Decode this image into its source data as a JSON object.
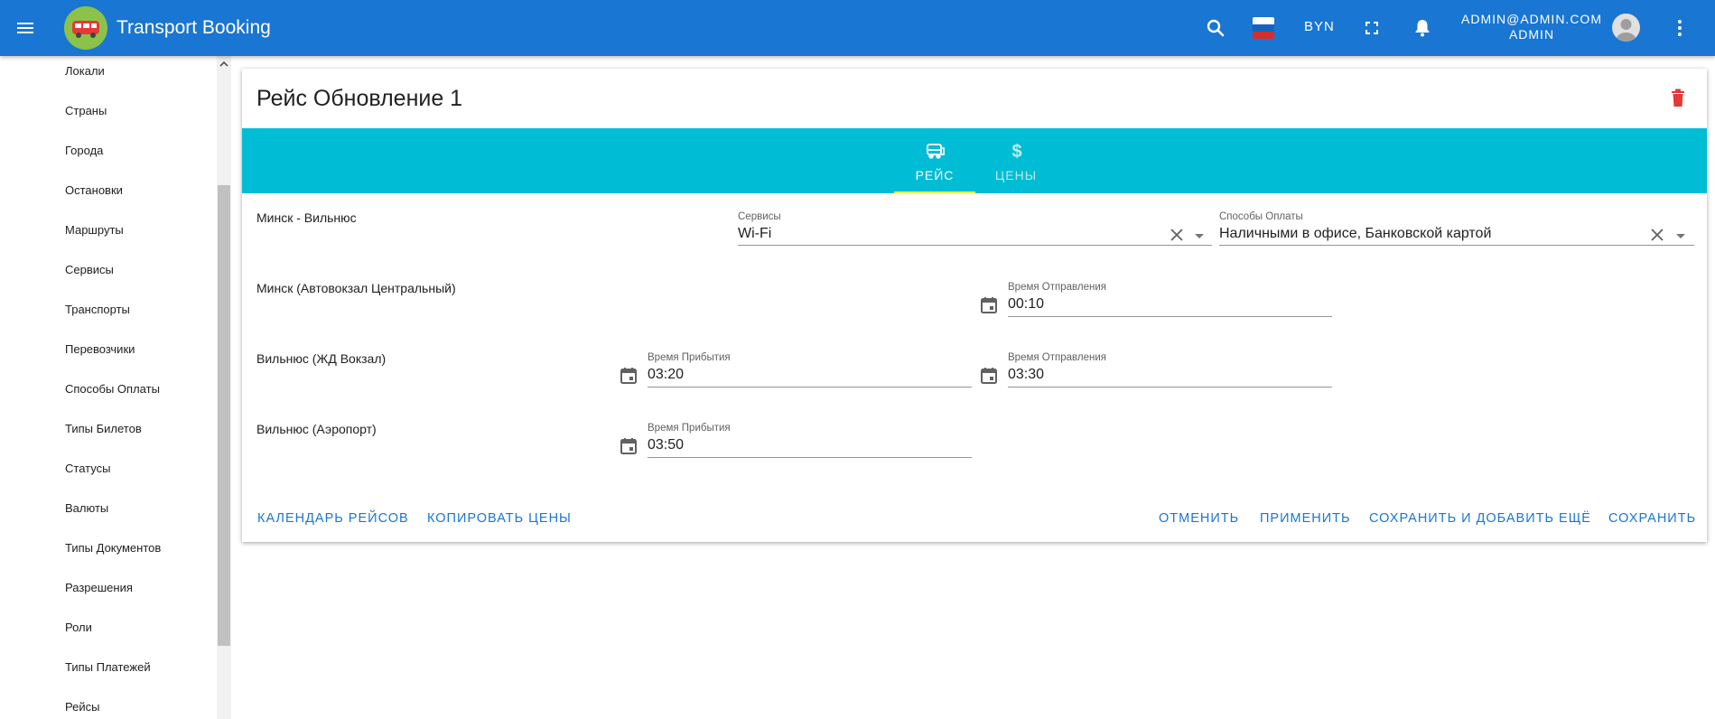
{
  "app": {
    "title": "Transport Booking",
    "currency": "BYN",
    "user_email": "ADMIN@ADMIN.COM",
    "user_role": "ADMIN",
    "brand_color": "#1976d2",
    "tab_bar_color": "#00bcd4",
    "tab_indicator_color": "#ffeb3b",
    "delete_color": "#e53935"
  },
  "sidebar": {
    "items": [
      {
        "label": "Локали"
      },
      {
        "label": "Страны"
      },
      {
        "label": "Города"
      },
      {
        "label": "Остановки"
      },
      {
        "label": "Маршруты"
      },
      {
        "label": "Сервисы"
      },
      {
        "label": "Транспорты"
      },
      {
        "label": "Перевозчики"
      },
      {
        "label": "Способы Оплаты"
      },
      {
        "label": "Типы Билетов"
      },
      {
        "label": "Статусы"
      },
      {
        "label": "Валюты"
      },
      {
        "label": "Типы Документов"
      },
      {
        "label": "Разрешения"
      },
      {
        "label": "Роли"
      },
      {
        "label": "Типы Платежей"
      },
      {
        "label": "Рейсы"
      }
    ]
  },
  "card": {
    "title": "Рейс Обновление 1",
    "tabs": [
      {
        "label": "РЕЙС",
        "icon": "bus-icon",
        "active": true
      },
      {
        "label": "ЦЕНЫ",
        "icon": "dollar-icon",
        "active": false
      }
    ],
    "route_name": "Минск - Вильнюс",
    "services": {
      "label": "Сервисы",
      "value": "Wi-Fi"
    },
    "payment_methods": {
      "label": "Способы Оплаты",
      "value": "Наличными в офисе, Банковской картой"
    },
    "stops": [
      {
        "name": "Минск (Автовокзал Центральный)",
        "departure_label": "Время Отправления",
        "departure": "00:10"
      },
      {
        "name": "Вильнюс (ЖД Вокзал)",
        "arrival_label": "Время Прибытия",
        "arrival": "03:20",
        "departure_label": "Время Отправления",
        "departure": "03:30"
      },
      {
        "name": "Вильнюс (Аэропорт)",
        "arrival_label": "Время Прибытия",
        "arrival": "03:50"
      }
    ],
    "actions": {
      "calendar": "КАЛЕНДАРЬ РЕЙСОВ",
      "copy_prices": "КОПИРОВАТЬ ЦЕНЫ",
      "cancel": "ОТМЕНИТЬ",
      "apply": "ПРИМЕНИТЬ",
      "save_add": "СОХРАНИТЬ И ДОБАВИТЬ ЕЩЁ",
      "save": "СОХРАНИТЬ"
    }
  }
}
